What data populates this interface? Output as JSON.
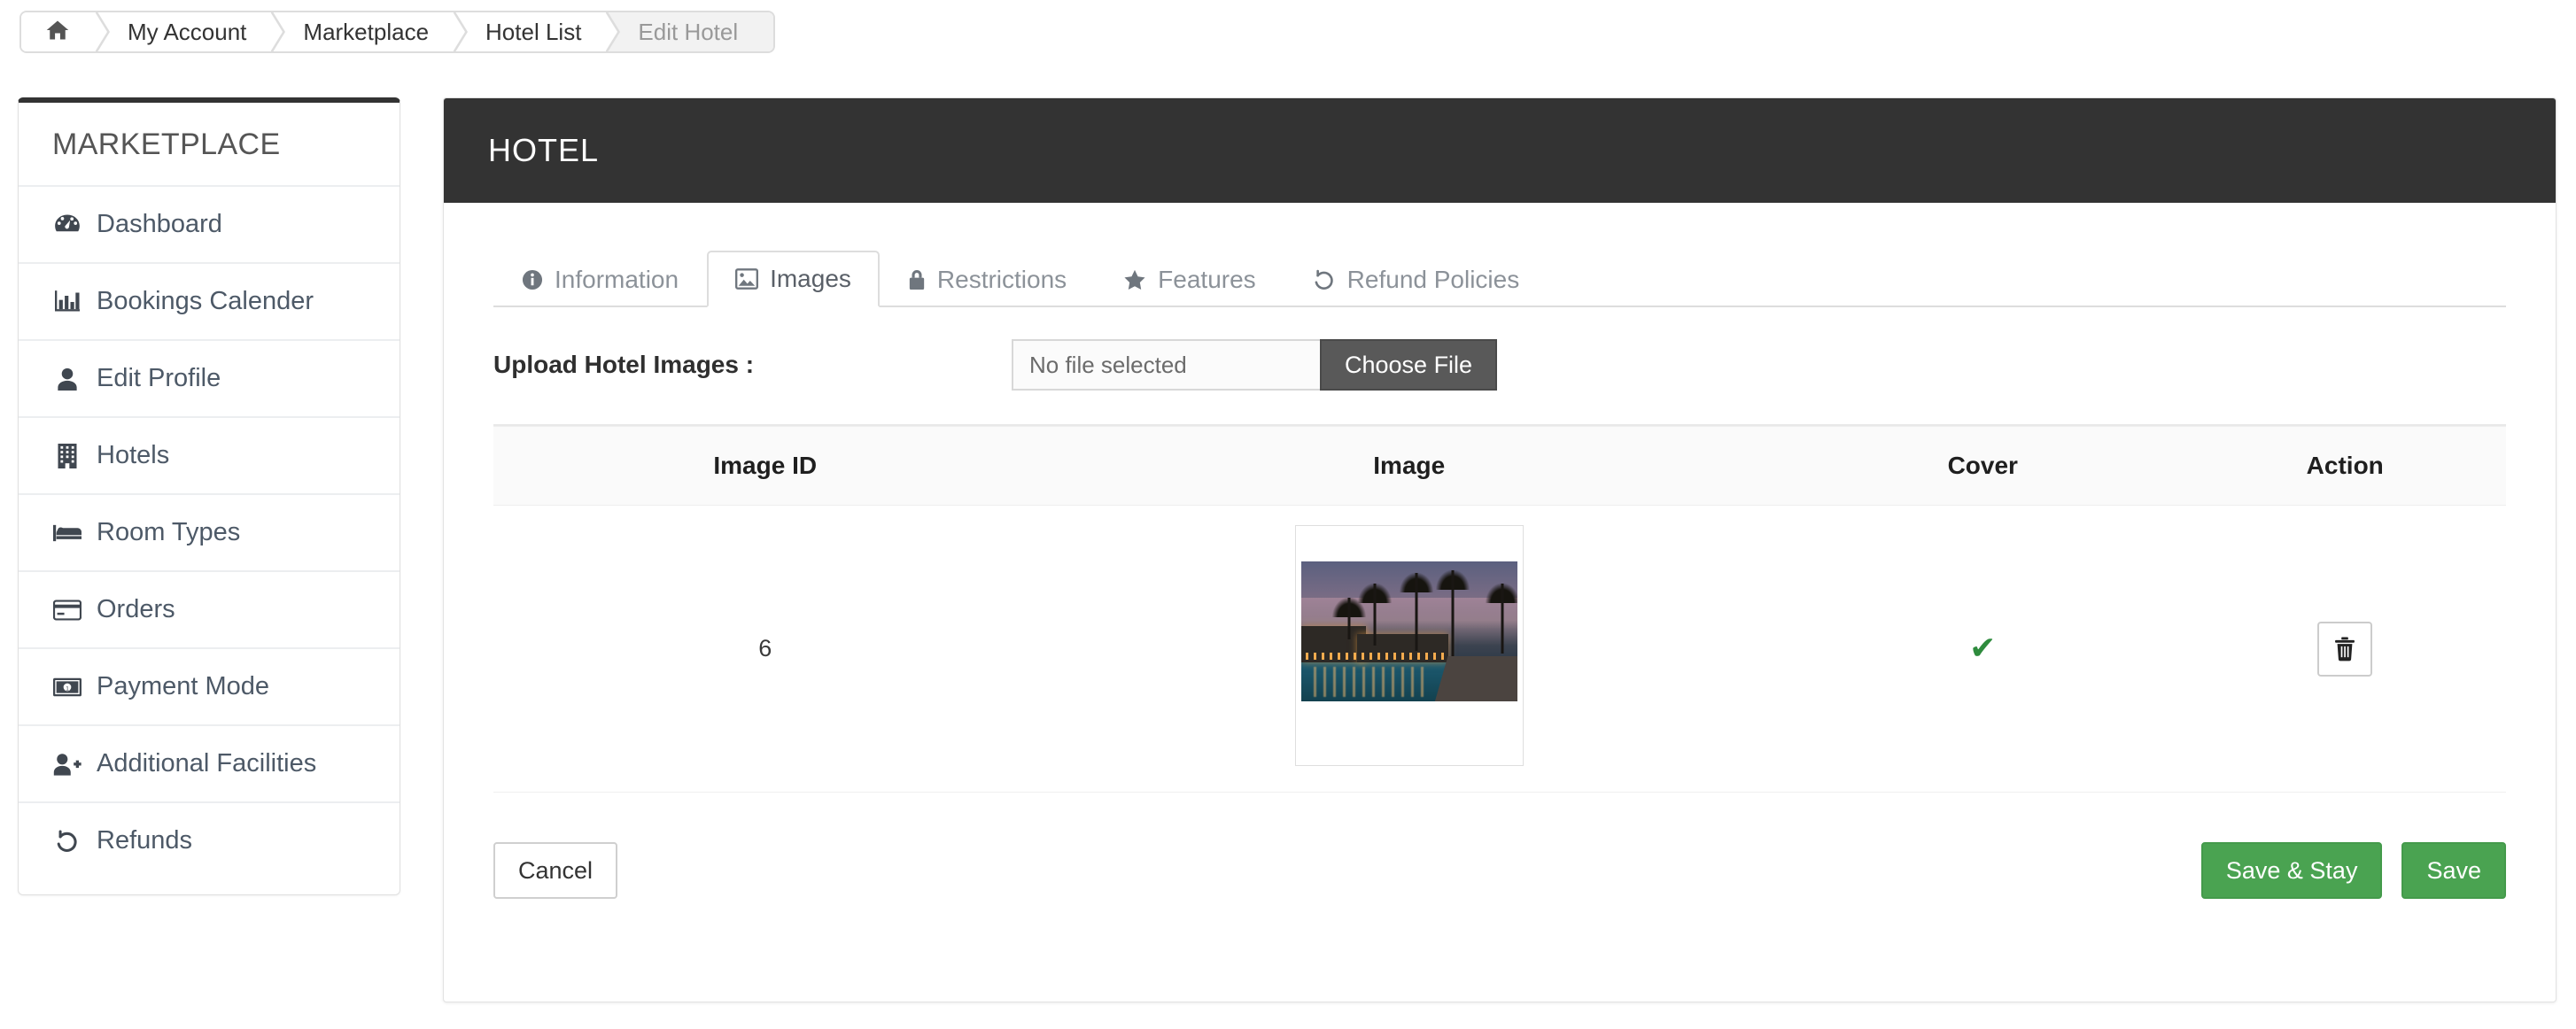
{
  "breadcrumb": {
    "home_icon": "home-icon",
    "items": [
      {
        "label": "My Account",
        "active": false
      },
      {
        "label": "Marketplace",
        "active": false
      },
      {
        "label": "Hotel List",
        "active": false
      },
      {
        "label": "Edit Hotel",
        "active": true
      }
    ]
  },
  "sidebar": {
    "title": "MARKETPLACE",
    "items": [
      {
        "label": "Dashboard",
        "icon": "dashboard-icon"
      },
      {
        "label": "Bookings Calender",
        "icon": "bar-chart-icon"
      },
      {
        "label": "Edit Profile",
        "icon": "user-icon"
      },
      {
        "label": "Hotels",
        "icon": "building-icon"
      },
      {
        "label": "Room Types",
        "icon": "bed-icon"
      },
      {
        "label": "Orders",
        "icon": "credit-card-icon"
      },
      {
        "label": "Payment Mode",
        "icon": "money-bill-icon"
      },
      {
        "label": "Additional Facilities",
        "icon": "user-plus-icon"
      },
      {
        "label": "Refunds",
        "icon": "undo-icon"
      }
    ]
  },
  "panel": {
    "title": "HOTEL",
    "header_bg": "#333333"
  },
  "tabs": [
    {
      "label": "Information",
      "icon": "info-circle-icon",
      "active": false
    },
    {
      "label": "Images",
      "icon": "image-icon",
      "active": true
    },
    {
      "label": "Restrictions",
      "icon": "lock-icon",
      "active": false
    },
    {
      "label": "Features",
      "icon": "star-icon",
      "active": false
    },
    {
      "label": "Refund Policies",
      "icon": "undo-icon",
      "active": false
    }
  ],
  "upload": {
    "label": "Upload Hotel Images :",
    "file_name": "No file selected",
    "choose_button": "Choose File"
  },
  "table": {
    "headers": [
      "Image ID",
      "Image",
      "Cover",
      "Action"
    ],
    "rows": [
      {
        "image_id": "6",
        "image_alt": "tropical-resort-at-dusk-thumbnail",
        "cover": "✔",
        "action_icon": "trash-icon"
      }
    ]
  },
  "footer": {
    "cancel_label": "Cancel",
    "save_stay_label": "Save & Stay",
    "save_label": "Save",
    "green": "#4aa351"
  }
}
